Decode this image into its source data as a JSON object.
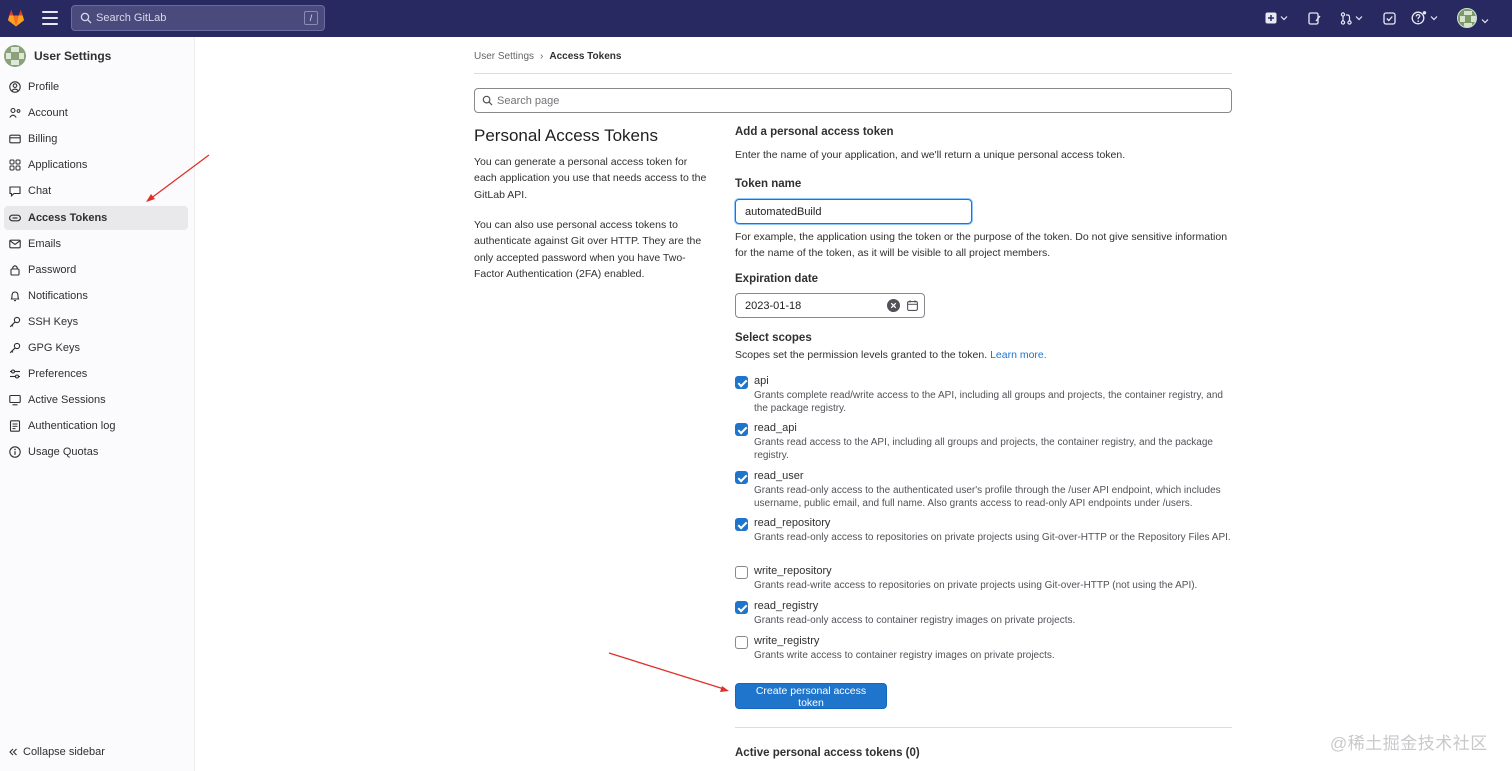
{
  "topbar": {
    "search_placeholder": "Search GitLab",
    "search_shortcut": "/"
  },
  "sidebar": {
    "title": "User Settings",
    "items": [
      {
        "label": "Profile",
        "icon": "profile-icon"
      },
      {
        "label": "Account",
        "icon": "account-icon"
      },
      {
        "label": "Billing",
        "icon": "billing-icon"
      },
      {
        "label": "Applications",
        "icon": "applications-icon"
      },
      {
        "label": "Chat",
        "icon": "chat-icon"
      },
      {
        "label": "Access Tokens",
        "icon": "token-icon",
        "active": true
      },
      {
        "label": "Emails",
        "icon": "mail-icon"
      },
      {
        "label": "Password",
        "icon": "lock-icon"
      },
      {
        "label": "Notifications",
        "icon": "bell-icon"
      },
      {
        "label": "SSH Keys",
        "icon": "key-icon"
      },
      {
        "label": "GPG Keys",
        "icon": "key-icon"
      },
      {
        "label": "Preferences",
        "icon": "preferences-icon"
      },
      {
        "label": "Active Sessions",
        "icon": "monitor-icon"
      },
      {
        "label": "Authentication log",
        "icon": "log-icon"
      },
      {
        "label": "Usage Quotas",
        "icon": "info-icon"
      }
    ],
    "collapse_label": "Collapse sidebar"
  },
  "breadcrumb": {
    "parent": "User Settings",
    "current": "Access Tokens"
  },
  "search_page": {
    "placeholder": "Search page"
  },
  "intro": {
    "title": "Personal Access Tokens",
    "p1": "You can generate a personal access token for each application you use that needs access to the GitLab API.",
    "p2": "You can also use personal access tokens to authenticate against Git over HTTP. They are the only accepted password when you have Two-Factor Authentication (2FA) enabled."
  },
  "form": {
    "heading": "Add a personal access token",
    "subheading": "Enter the name of your application, and we'll return a unique personal access token.",
    "token_name_label": "Token name",
    "token_name_value": "automatedBuild",
    "token_name_help": "For example, the application using the token or the purpose of the token. Do not give sensitive information for the name of the token, as it will be visible to all project members.",
    "expiration_label": "Expiration date",
    "expiration_value": "2023-01-18",
    "scopes_label": "Select scopes",
    "scopes_help": "Scopes set the permission levels granted to the token.",
    "scopes_link": "Learn more.",
    "scopes": [
      {
        "name": "api",
        "checked": true,
        "desc": "Grants complete read/write access to the API, including all groups and projects, the container registry, and the package registry."
      },
      {
        "name": "read_api",
        "checked": true,
        "desc": "Grants read access to the API, including all groups and projects, the container registry, and the package registry."
      },
      {
        "name": "read_user",
        "checked": true,
        "desc": "Grants read-only access to the authenticated user's profile through the /user API endpoint, which includes username, public email, and full name. Also grants access to read-only API endpoints under /users."
      },
      {
        "name": "read_repository",
        "checked": true,
        "desc": "Grants read-only access to repositories on private projects using Git-over-HTTP or the Repository Files API."
      },
      {
        "name": "write_repository",
        "checked": false,
        "desc": "Grants read-write access to repositories on private projects using Git-over-HTTP (not using the API)."
      },
      {
        "name": "read_registry",
        "checked": true,
        "desc": "Grants read-only access to container registry images on private projects."
      },
      {
        "name": "write_registry",
        "checked": false,
        "desc": "Grants write access to container registry images on private projects."
      }
    ],
    "submit_label": "Create personal access token"
  },
  "active_tokens_title": "Active personal access tokens (0)",
  "watermark": "@稀土掘金技术社区",
  "colors": {
    "topbar": "#292961",
    "primary": "#1f75cb",
    "annotation_arrow": "#e0302b"
  }
}
